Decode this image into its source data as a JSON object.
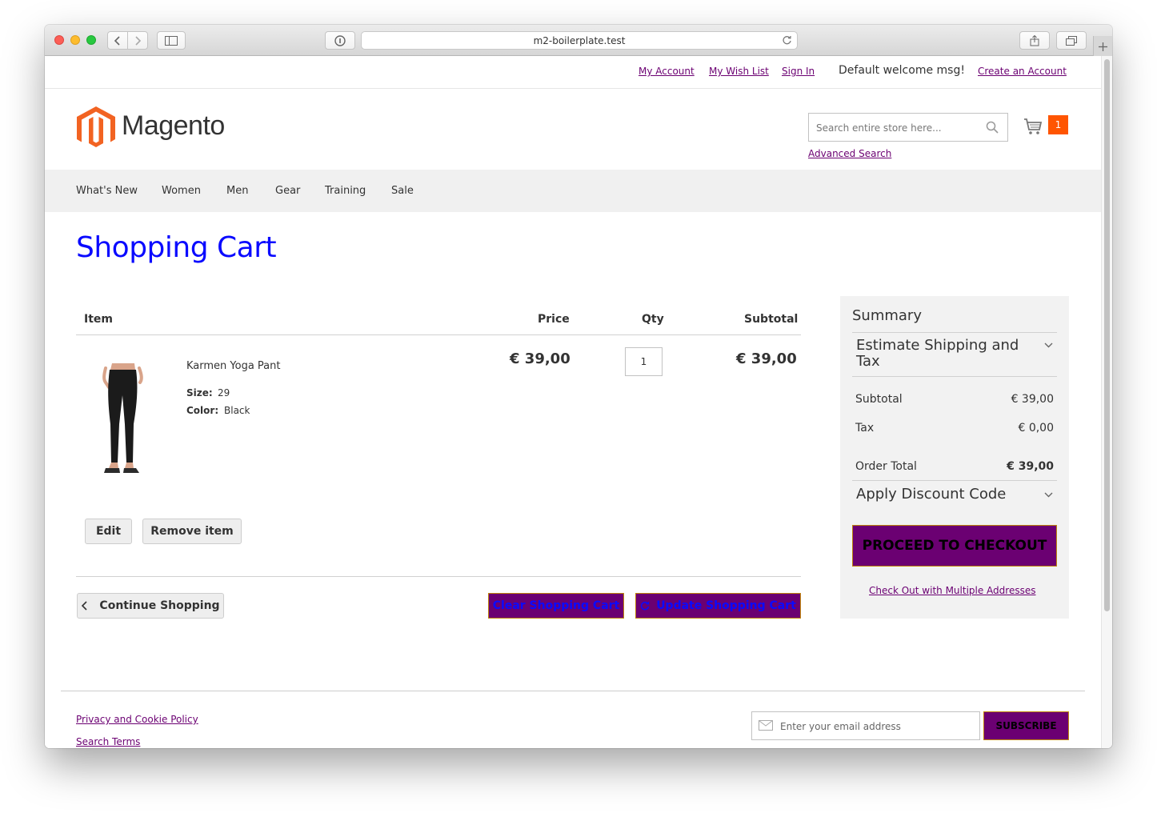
{
  "browser": {
    "url": "m2-boilerplate.test"
  },
  "header": {
    "links": {
      "my_account": "My Account",
      "my_wish_list": "My Wish List",
      "sign_in": "Sign In",
      "welcome": "Default welcome msg!",
      "create_account": "Create an Account"
    },
    "logo_text": "Magento",
    "search_placeholder": "Search entire store here...",
    "advanced_search": "Advanced Search",
    "cart_count": "1"
  },
  "nav": {
    "items": [
      "What's New",
      "Women",
      "Men",
      "Gear",
      "Training",
      "Sale"
    ]
  },
  "page": {
    "title": "Shopping Cart"
  },
  "cart": {
    "columns": {
      "item": "Item",
      "price": "Price",
      "qty": "Qty",
      "subtotal": "Subtotal"
    },
    "items": [
      {
        "name": "Karmen Yoga Pant",
        "size_label": "Size:",
        "size_value": "29",
        "color_label": "Color:",
        "color_value": "Black",
        "price": "€ 39,00",
        "qty": "1",
        "subtotal": "€ 39,00"
      }
    ],
    "edit_label": "Edit",
    "remove_label": "Remove item",
    "continue_label": "Continue Shopping",
    "clear_label": "Clear Shopping Cart",
    "update_label": "Update Shopping Cart"
  },
  "summary": {
    "title": "Summary",
    "estimate_label": "Estimate Shipping and Tax",
    "subtotal_label": "Subtotal",
    "subtotal_value": "€ 39,00",
    "tax_label": "Tax",
    "tax_value": "€ 0,00",
    "order_total_label": "Order Total",
    "order_total_value": "€ 39,00",
    "discount_label": "Apply Discount Code",
    "checkout_label": "PROCEED TO CHECKOUT",
    "multi_address_label": "Check Out with Multiple Addresses"
  },
  "footer": {
    "privacy": "Privacy and Cookie Policy",
    "search_terms": "Search Terms",
    "email_placeholder": "Enter your email address",
    "subscribe": "SUBSCRIBE"
  },
  "colors": {
    "brand_orange": "#f26322",
    "accent_purple": "#6b0072",
    "title_blue": "#0a0aff",
    "cart_badge": "#ff5501"
  }
}
